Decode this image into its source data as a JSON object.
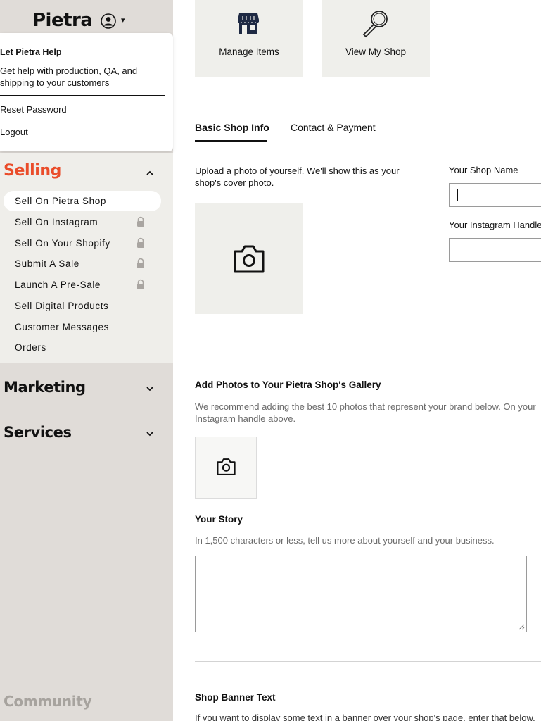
{
  "sidebar": {
    "logo": "Pietra",
    "user_menu_caret": "▾",
    "dropdown": {
      "help_title": "Let Pietra Help",
      "help_desc": "Get help with production, QA, and shipping to your customers",
      "reset_password": "Reset Password",
      "logout": "Logout"
    },
    "selling": {
      "title": "Selling",
      "chevron": "⌃",
      "items": [
        {
          "label": "Sell On Pietra Shop",
          "active": true,
          "locked": false
        },
        {
          "label": "Sell On Instagram",
          "active": false,
          "locked": true
        },
        {
          "label": "Sell On Your Shopify",
          "active": false,
          "locked": true
        },
        {
          "label": "Submit A Sale",
          "active": false,
          "locked": true
        },
        {
          "label": "Launch A Pre-Sale",
          "active": false,
          "locked": true
        },
        {
          "label": "Sell Digital Products",
          "active": false,
          "locked": false
        },
        {
          "label": "Customer Messages",
          "active": false,
          "locked": false
        },
        {
          "label": "Orders",
          "active": false,
          "locked": false
        }
      ]
    },
    "marketing": {
      "title": "Marketing",
      "chevron": "⌄"
    },
    "services": {
      "title": "Services",
      "chevron": "⌄"
    },
    "community": "Community"
  },
  "main": {
    "tiles": [
      {
        "label": "Manage Items",
        "icon": "storefront-icon"
      },
      {
        "label": "View My Shop",
        "icon": "magnifier-icon"
      }
    ],
    "tabs": [
      {
        "label": "Basic Shop Info",
        "active": true
      },
      {
        "label": "Contact & Payment",
        "active": false
      }
    ],
    "cover_photo_desc": "Upload a photo of yourself. We'll show this as your shop's cover photo.",
    "shop_name_label": "Your Shop Name",
    "shop_name_value": "",
    "instagram_label": "Your Instagram Handle",
    "instagram_value": "",
    "gallery_title": "Add Photos to Your Pietra Shop's Gallery",
    "gallery_desc": "We recommend adding the best 10 photos that represent your brand below. On your Instagram handle above.",
    "story_title": "Your Story",
    "story_desc": "In 1,500 characters or less, tell us more about yourself and your business.",
    "story_value": "",
    "banner_title": "Shop Banner Text",
    "banner_desc": "If you want to display some text in a banner over your shop's page, enter that below."
  },
  "colors": {
    "accent": "#ea4c2a",
    "sidebar_bg": "#e0dcd8",
    "selling_bg": "#efeeea",
    "tile_bg": "#efefeb",
    "muted_text": "#6b6b6b"
  }
}
